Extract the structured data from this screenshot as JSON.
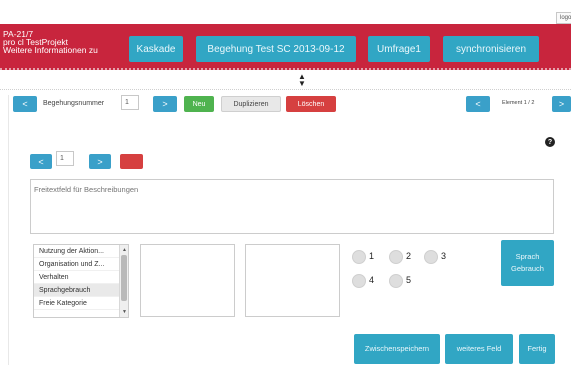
{
  "topbar": {
    "login_label": "logou"
  },
  "project": {
    "line1": "PA-21/7",
    "line2": "pro cl TestProjekt",
    "line3": "Weitere Informationen zu"
  },
  "header_buttons": {
    "kaskade": "Kaskade",
    "begehung": "Begehung Test SC 2013-09-12",
    "umfrage": "Umfrage1",
    "sync": "synchronisieren"
  },
  "nav": {
    "prev": "<",
    "next": ">",
    "begehungsnummer_label": "Begehungsnummer",
    "begehungsnummer_value": "1",
    "neu": "Neu",
    "duplizieren": "Duplizieren",
    "loeschen": "Löschen",
    "element_label": "Element 1 / 2"
  },
  "element_nav": {
    "prev": "<",
    "next": ">",
    "value": "1"
  },
  "description": {
    "placeholder": "Freitextfeld für Beschreibungen"
  },
  "categories": [
    {
      "label": "Nutzung der Aktion..."
    },
    {
      "label": "Organisation und Z..."
    },
    {
      "label": "Verhalten"
    },
    {
      "label": "Sprachgebrauch"
    },
    {
      "label": "Freie Kategorie"
    }
  ],
  "rating": [
    {
      "label": "1"
    },
    {
      "label": "2"
    },
    {
      "label": "3"
    },
    {
      "label": "4"
    },
    {
      "label": "5"
    }
  ],
  "sprach_button": {
    "line1": "Sprach",
    "line2": "Gebrauch"
  },
  "footer": {
    "zwischenspeichern": "Zwischenspeichern",
    "weiteres_feld": "weiteres Feld",
    "fertig": "Fertig"
  },
  "colors": {
    "header_red": "#c8253d",
    "teal": "#31a6c4",
    "nav_blue": "#3aa0c9",
    "green": "#4fb34f",
    "red_button": "#d64040"
  }
}
